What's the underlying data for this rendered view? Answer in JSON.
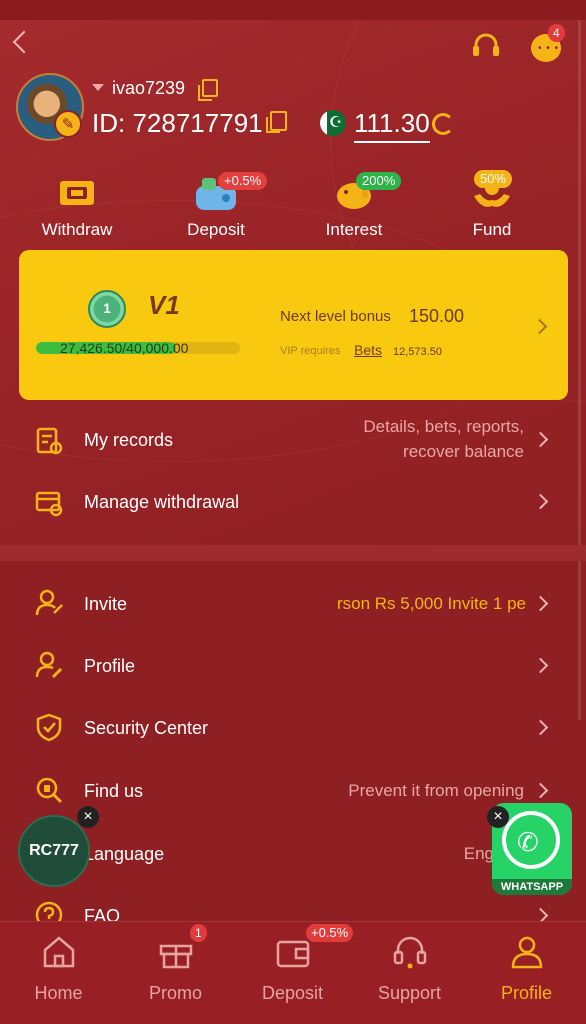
{
  "header": {
    "username": "ivao7239",
    "id_label": "ID:",
    "id_value": "728717791",
    "balance": "111.30",
    "chat_badge": "4"
  },
  "quick_actions": [
    {
      "label": "Withdraw",
      "icon": "ticket-icon",
      "badge": ""
    },
    {
      "label": "Deposit",
      "icon": "wallet-icon",
      "badge": "+0.5%"
    },
    {
      "label": "Interest",
      "icon": "piggy-bank-icon",
      "badge": "200%"
    },
    {
      "label": "Fund",
      "icon": "hands-coin-icon",
      "badge": "50%"
    }
  ],
  "vip": {
    "medal_number": "1",
    "level": "V1",
    "progress_text": "27,426.50/40,000.00",
    "progress_fraction": 0.686,
    "next_level_label": "Next level bonus",
    "next_level_value": "150.00",
    "requires_label": "VIP requires",
    "bets_link": "Bets",
    "requires_value": "12,573.50"
  },
  "records": {
    "label": "My records",
    "value_line1": "Details, bets, reports,",
    "value_line2": "recover balance"
  },
  "manage_withdrawal": {
    "label": "Manage withdrawal"
  },
  "invite": {
    "label": "Invite",
    "value": "rson Rs 5,000  Invite 1 pe"
  },
  "profile": {
    "label": "Profile"
  },
  "security": {
    "label": "Security Center"
  },
  "find_us": {
    "label": "Find us",
    "value": "Prevent it from opening"
  },
  "language": {
    "label": "Language",
    "value": "Eng"
  },
  "faq": {
    "label": "FAQ"
  },
  "floating": {
    "rc_logo": "RC777",
    "whatsapp_label": "WHATSAPP",
    "close": "×"
  },
  "tabs": [
    {
      "label": "Home",
      "icon": "home-icon",
      "badge": ""
    },
    {
      "label": "Promo",
      "icon": "gift-icon",
      "badge": "1"
    },
    {
      "label": "Deposit",
      "icon": "wallet-icon",
      "badge": "+0.5%"
    },
    {
      "label": "Support",
      "icon": "headset-icon",
      "badge": ""
    },
    {
      "label": "Profile",
      "icon": "user-icon",
      "badge": ""
    }
  ],
  "colors": {
    "background": "#8e1f22",
    "accent": "#f4b417",
    "vip_card": "#f9c90f",
    "progress": "#3dbd3d"
  }
}
